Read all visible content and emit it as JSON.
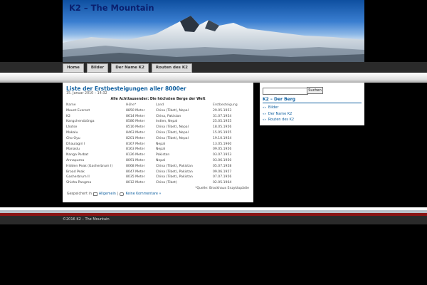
{
  "site": {
    "title": "K2 – The Mountain"
  },
  "nav": {
    "items": [
      "Home",
      "Bilder",
      "Der Name K2",
      "Routen des K2"
    ]
  },
  "post": {
    "title": "Liste der Erstbesteigungen aller 8000er",
    "date": "15. Januar 2010 – 14:32",
    "caption": "Alle Achttausender: Die höchsten Berge der Welt",
    "columns": [
      "Name",
      "Höhe*",
      "Land",
      "Erstbesteigung"
    ],
    "rows": [
      [
        "Mount Everest",
        "8850 Meter",
        "China (Tibet), Nepal",
        "29.05.1953"
      ],
      [
        "K2",
        "8614 Meter",
        "China, Pakistan",
        "31.07.1954"
      ],
      [
        "Kangchendzönga",
        "8586 Meter",
        "Indien, Nepal",
        "25.05.1955"
      ],
      [
        "Lhotse",
        "8516 Meter",
        "China (Tibet), Nepal",
        "18.05.1956"
      ],
      [
        "Makalu",
        "8463 Meter",
        "China (Tibet), Nepal",
        "15.05.1955"
      ],
      [
        "Cho Oyu",
        "8201 Meter",
        "China (Tibet), Nepal",
        "19.10.1954"
      ],
      [
        "Dhaulagiri I",
        "8167 Meter",
        "Nepal",
        "13.05.1960"
      ],
      [
        "Manaslu",
        "8163 Meter",
        "Nepal",
        "09.05.1956"
      ],
      [
        "Nanga Parbat",
        "8126 Meter",
        "Pakistan",
        "03.07.1953"
      ],
      [
        "Annapurna",
        "8091 Meter",
        "Nepal",
        "03.06.1950"
      ],
      [
        "Hidden Peak (Gasherbrum I)",
        "8068 Meter",
        "China (Tibet), Pakistan",
        "05.07.1958"
      ],
      [
        "Broad Peak",
        "8047 Meter",
        "China (Tibet), Pakistan",
        "09.06.1957"
      ],
      [
        "Gasherbrum II",
        "8035 Meter",
        "China (Tibet), Pakistan",
        "07.07.1956"
      ],
      [
        "Shisha Pangma",
        "8012 Meter",
        "China (Tibet)",
        "02.05.1964"
      ]
    ],
    "source": "*Quelle: Brockhaus Enzyklopädie",
    "meta_prefix": "Gespeichert in",
    "category": "Allgemein",
    "separator": "|",
    "comments": "Keine Kommentare »"
  },
  "sidebar": {
    "search_value": "",
    "search_button": "Suchen",
    "widget_title": "K2 – Der Berg",
    "links": [
      "Bilder",
      "Der Name K2",
      "Routen des K2"
    ]
  },
  "footer": {
    "text": "©2016 K2 – The Mountain"
  },
  "icons": {
    "category": "folder-icon",
    "comments": "comment-icon",
    "list_bullet": "double-arrow-icon"
  },
  "colors": {
    "link": "#1060a0",
    "footer_accent": "#8a1515",
    "title": "#0a1f6e"
  }
}
